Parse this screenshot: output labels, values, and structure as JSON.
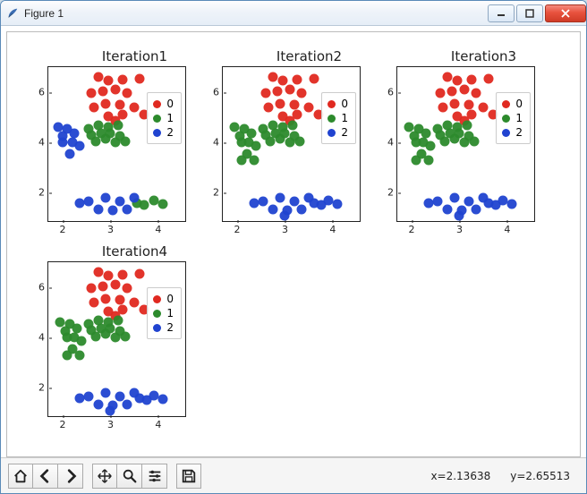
{
  "window": {
    "title": "Figure 1"
  },
  "status": {
    "x_label": "x=2.13638",
    "y_label": "y=2.65513"
  },
  "colors": {
    "0": "#e02920",
    "1": "#2c8a2c",
    "2": "#2043d0"
  },
  "legend_items": [
    {
      "label": "0",
      "color": "#e02920"
    },
    {
      "label": "1",
      "color": "#2c8a2c"
    },
    {
      "label": "2",
      "color": "#2043d0"
    }
  ],
  "chart_data": [
    {
      "title": "Iteration1",
      "type": "scatter",
      "xlabel": "",
      "ylabel": "",
      "xlim": [
        1.7,
        4.6
      ],
      "ylim": [
        0.8,
        7.0
      ],
      "xticks": [
        2,
        3,
        4
      ],
      "yticks": [
        2,
        4,
        6
      ],
      "series": [
        {
          "name": "0",
          "color": "#e02920",
          "points": [
            [
              2.75,
              6.6
            ],
            [
              2.95,
              6.45
            ],
            [
              3.25,
              6.5
            ],
            [
              3.6,
              6.55
            ],
            [
              2.6,
              5.95
            ],
            [
              2.85,
              6.05
            ],
            [
              3.1,
              6.1
            ],
            [
              3.35,
              5.95
            ],
            [
              2.65,
              5.4
            ],
            [
              2.9,
              5.55
            ],
            [
              3.2,
              5.5
            ],
            [
              3.5,
              5.4
            ],
            [
              2.95,
              5.05
            ],
            [
              3.25,
              5.1
            ],
            [
              3.1,
              4.85
            ],
            [
              3.7,
              5.1
            ]
          ]
        },
        {
          "name": "1",
          "color": "#2c8a2c",
          "points": [
            [
              2.55,
              4.55
            ],
            [
              2.75,
              4.7
            ],
            [
              2.95,
              4.6
            ],
            [
              3.15,
              4.7
            ],
            [
              2.6,
              4.3
            ],
            [
              2.8,
              4.35
            ],
            [
              3.0,
              4.35
            ],
            [
              3.2,
              4.25
            ],
            [
              2.7,
              4.05
            ],
            [
              2.9,
              4.15
            ],
            [
              3.1,
              4.0
            ],
            [
              3.3,
              4.05
            ],
            [
              3.55,
              1.6
            ],
            [
              3.7,
              1.5
            ],
            [
              3.9,
              1.7
            ],
            [
              4.1,
              1.55
            ]
          ]
        },
        {
          "name": "2",
          "color": "#2043d0",
          "points": [
            [
              1.9,
              4.6
            ],
            [
              2.1,
              4.55
            ],
            [
              2.0,
              4.25
            ],
            [
              2.25,
              4.35
            ],
            [
              2.0,
              4.0
            ],
            [
              2.2,
              4.0
            ],
            [
              2.35,
              3.85
            ],
            [
              2.15,
              3.55
            ],
            [
              2.35,
              1.6
            ],
            [
              2.55,
              1.65
            ],
            [
              2.75,
              1.35
            ],
            [
              2.9,
              1.8
            ],
            [
              3.05,
              1.3
            ],
            [
              3.2,
              1.65
            ],
            [
              3.35,
              1.35
            ],
            [
              3.5,
              1.8
            ]
          ]
        }
      ]
    },
    {
      "title": "Iteration2",
      "type": "scatter",
      "xlabel": "",
      "ylabel": "",
      "xlim": [
        1.7,
        4.6
      ],
      "ylim": [
        0.8,
        7.0
      ],
      "xticks": [
        2,
        3,
        4
      ],
      "yticks": [
        2,
        4,
        6
      ],
      "series": [
        {
          "name": "0",
          "color": "#e02920",
          "points": [
            [
              2.75,
              6.6
            ],
            [
              2.95,
              6.45
            ],
            [
              3.25,
              6.5
            ],
            [
              3.6,
              6.55
            ],
            [
              2.6,
              5.95
            ],
            [
              2.85,
              6.05
            ],
            [
              3.1,
              6.1
            ],
            [
              3.35,
              5.95
            ],
            [
              2.65,
              5.4
            ],
            [
              2.9,
              5.55
            ],
            [
              3.2,
              5.5
            ],
            [
              3.5,
              5.4
            ],
            [
              2.95,
              5.05
            ],
            [
              3.25,
              5.1
            ],
            [
              3.1,
              4.85
            ],
            [
              3.7,
              5.1
            ]
          ]
        },
        {
          "name": "1",
          "color": "#2c8a2c",
          "points": [
            [
              1.95,
              4.6
            ],
            [
              2.15,
              4.55
            ],
            [
              2.05,
              4.25
            ],
            [
              2.3,
              4.35
            ],
            [
              2.1,
              4.0
            ],
            [
              2.25,
              4.0
            ],
            [
              2.4,
              3.85
            ],
            [
              2.2,
              3.55
            ],
            [
              2.55,
              4.55
            ],
            [
              2.75,
              4.7
            ],
            [
              2.95,
              4.6
            ],
            [
              3.15,
              4.7
            ],
            [
              2.6,
              4.3
            ],
            [
              2.8,
              4.35
            ],
            [
              3.0,
              4.35
            ],
            [
              3.2,
              4.25
            ],
            [
              2.7,
              4.05
            ],
            [
              2.9,
              4.15
            ],
            [
              3.1,
              4.0
            ],
            [
              3.3,
              4.05
            ],
            [
              2.1,
              3.3
            ],
            [
              2.35,
              3.3
            ]
          ]
        },
        {
          "name": "2",
          "color": "#2043d0",
          "points": [
            [
              2.35,
              1.6
            ],
            [
              2.55,
              1.65
            ],
            [
              2.75,
              1.35
            ],
            [
              2.9,
              1.8
            ],
            [
              3.05,
              1.3
            ],
            [
              3.2,
              1.65
            ],
            [
              3.35,
              1.35
            ],
            [
              3.5,
              1.8
            ],
            [
              3.6,
              1.6
            ],
            [
              3.75,
              1.5
            ],
            [
              3.9,
              1.7
            ],
            [
              4.1,
              1.55
            ],
            [
              3.0,
              1.1
            ]
          ]
        }
      ]
    },
    {
      "title": "Iteration3",
      "type": "scatter",
      "xlabel": "",
      "ylabel": "",
      "xlim": [
        1.7,
        4.6
      ],
      "ylim": [
        0.8,
        7.0
      ],
      "xticks": [
        2,
        3,
        4
      ],
      "yticks": [
        2,
        4,
        6
      ],
      "series": [
        {
          "name": "0",
          "color": "#e02920",
          "points": [
            [
              2.75,
              6.6
            ],
            [
              2.95,
              6.45
            ],
            [
              3.25,
              6.5
            ],
            [
              3.6,
              6.55
            ],
            [
              2.6,
              5.95
            ],
            [
              2.85,
              6.05
            ],
            [
              3.1,
              6.1
            ],
            [
              3.35,
              5.95
            ],
            [
              2.65,
              5.4
            ],
            [
              2.9,
              5.55
            ],
            [
              3.2,
              5.5
            ],
            [
              3.5,
              5.4
            ],
            [
              2.95,
              5.05
            ],
            [
              3.25,
              5.1
            ],
            [
              3.1,
              4.85
            ],
            [
              3.7,
              5.1
            ]
          ]
        },
        {
          "name": "1",
          "color": "#2c8a2c",
          "points": [
            [
              1.95,
              4.6
            ],
            [
              2.15,
              4.55
            ],
            [
              2.05,
              4.25
            ],
            [
              2.3,
              4.35
            ],
            [
              2.1,
              4.0
            ],
            [
              2.25,
              4.0
            ],
            [
              2.4,
              3.85
            ],
            [
              2.2,
              3.55
            ],
            [
              2.55,
              4.55
            ],
            [
              2.75,
              4.7
            ],
            [
              2.95,
              4.6
            ],
            [
              3.15,
              4.7
            ],
            [
              2.6,
              4.3
            ],
            [
              2.8,
              4.35
            ],
            [
              3.0,
              4.35
            ],
            [
              3.2,
              4.25
            ],
            [
              2.7,
              4.05
            ],
            [
              2.9,
              4.15
            ],
            [
              3.1,
              4.0
            ],
            [
              3.3,
              4.05
            ],
            [
              2.1,
              3.3
            ],
            [
              2.35,
              3.3
            ]
          ]
        },
        {
          "name": "2",
          "color": "#2043d0",
          "points": [
            [
              2.35,
              1.6
            ],
            [
              2.55,
              1.65
            ],
            [
              2.75,
              1.35
            ],
            [
              2.9,
              1.8
            ],
            [
              3.05,
              1.3
            ],
            [
              3.2,
              1.65
            ],
            [
              3.35,
              1.35
            ],
            [
              3.5,
              1.8
            ],
            [
              3.6,
              1.6
            ],
            [
              3.75,
              1.5
            ],
            [
              3.9,
              1.7
            ],
            [
              4.1,
              1.55
            ],
            [
              3.0,
              1.1
            ]
          ]
        }
      ]
    },
    {
      "title": "Iteration4",
      "type": "scatter",
      "xlabel": "",
      "ylabel": "",
      "xlim": [
        1.7,
        4.6
      ],
      "ylim": [
        0.8,
        7.0
      ],
      "xticks": [
        2,
        3,
        4
      ],
      "yticks": [
        2,
        4,
        6
      ],
      "series": [
        {
          "name": "0",
          "color": "#e02920",
          "points": [
            [
              2.75,
              6.6
            ],
            [
              2.95,
              6.45
            ],
            [
              3.25,
              6.5
            ],
            [
              3.6,
              6.55
            ],
            [
              2.6,
              5.95
            ],
            [
              2.85,
              6.05
            ],
            [
              3.1,
              6.1
            ],
            [
              3.35,
              5.95
            ],
            [
              2.65,
              5.4
            ],
            [
              2.9,
              5.55
            ],
            [
              3.2,
              5.5
            ],
            [
              3.5,
              5.4
            ],
            [
              2.95,
              5.05
            ],
            [
              3.25,
              5.1
            ],
            [
              3.1,
              4.85
            ],
            [
              3.7,
              5.1
            ]
          ]
        },
        {
          "name": "1",
          "color": "#2c8a2c",
          "points": [
            [
              1.95,
              4.6
            ],
            [
              2.15,
              4.55
            ],
            [
              2.05,
              4.25
            ],
            [
              2.3,
              4.35
            ],
            [
              2.1,
              4.0
            ],
            [
              2.25,
              4.0
            ],
            [
              2.4,
              3.85
            ],
            [
              2.2,
              3.55
            ],
            [
              2.55,
              4.55
            ],
            [
              2.75,
              4.7
            ],
            [
              2.95,
              4.6
            ],
            [
              3.15,
              4.7
            ],
            [
              2.6,
              4.3
            ],
            [
              2.8,
              4.35
            ],
            [
              3.0,
              4.35
            ],
            [
              3.2,
              4.25
            ],
            [
              2.7,
              4.05
            ],
            [
              2.9,
              4.15
            ],
            [
              3.1,
              4.0
            ],
            [
              3.3,
              4.05
            ],
            [
              2.1,
              3.3
            ],
            [
              2.35,
              3.3
            ]
          ]
        },
        {
          "name": "2",
          "color": "#2043d0",
          "points": [
            [
              2.35,
              1.6
            ],
            [
              2.55,
              1.65
            ],
            [
              2.75,
              1.35
            ],
            [
              2.9,
              1.8
            ],
            [
              3.05,
              1.3
            ],
            [
              3.2,
              1.65
            ],
            [
              3.35,
              1.35
            ],
            [
              3.5,
              1.8
            ],
            [
              3.6,
              1.6
            ],
            [
              3.75,
              1.5
            ],
            [
              3.9,
              1.7
            ],
            [
              4.1,
              1.55
            ],
            [
              3.0,
              1.1
            ]
          ]
        }
      ]
    }
  ]
}
